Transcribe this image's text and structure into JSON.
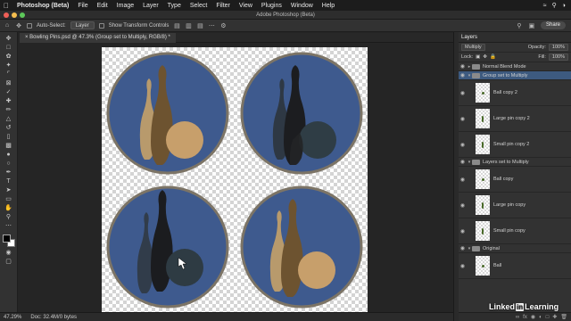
{
  "menubar": {
    "app": "Photoshop (Beta)",
    "items": [
      "File",
      "Edit",
      "Image",
      "Layer",
      "Type",
      "Select",
      "Filter",
      "View",
      "Plugins",
      "Window",
      "Help"
    ]
  },
  "window": {
    "title": "Adobe Photoshop (Beta)"
  },
  "options": {
    "auto_select_label": "Auto-Select:",
    "auto_select_value": "Layer",
    "transform_label": "Show Transform Controls",
    "share_label": "Share"
  },
  "document": {
    "tab_title": "Bowling Pins.psd @ 47.3% (Group set to Multiply, RGB/8) *"
  },
  "status": {
    "zoom": "47.29%",
    "doc_info": "Doc: 32.4M/0 bytes"
  },
  "layers_panel": {
    "tab": "Layers",
    "blend_mode": "Multiply",
    "opacity_label": "Opacity:",
    "opacity_value": "100%",
    "lock_label": "Lock:",
    "fill_label": "Fill:",
    "fill_value": "100%",
    "rows": [
      {
        "type": "group",
        "name": "Normal Blend Mode",
        "expanded": false,
        "selected": false
      },
      {
        "type": "group",
        "name": "Group set to Multiply",
        "expanded": true,
        "selected": true
      },
      {
        "type": "layer",
        "name": "Ball copy 2",
        "thumb": "ball"
      },
      {
        "type": "layer",
        "name": "Large pin copy 2",
        "thumb": "pin"
      },
      {
        "type": "layer",
        "name": "Small pin copy 2",
        "thumb": "pin"
      },
      {
        "type": "group",
        "name": "Layers set to Multiply",
        "expanded": true,
        "selected": false
      },
      {
        "type": "layer",
        "name": "Ball copy",
        "thumb": "ball"
      },
      {
        "type": "layer",
        "name": "Large pin copy",
        "thumb": "pin"
      },
      {
        "type": "layer",
        "name": "Small pin copy",
        "thumb": "pin"
      },
      {
        "type": "group",
        "name": "Original",
        "expanded": true,
        "selected": false
      },
      {
        "type": "layer",
        "name": "Ball",
        "thumb": "ball"
      }
    ]
  },
  "watermark": {
    "brand": "Linked",
    "in": "in",
    "suffix": " Learning"
  },
  "colors": {
    "circle_fill": "#3e5a8e",
    "circle_ring": "#7c7466",
    "tan": "#b89a6c",
    "brown": "#6d5330",
    "selection_blue": "#3d5a7f"
  },
  "icons": [
    "apple-icon",
    "move-tool-icon",
    "home-icon",
    "eye-icon",
    "folder-icon",
    "chevron-icon",
    "gear-icon",
    "search-icon",
    "lock-icon"
  ]
}
